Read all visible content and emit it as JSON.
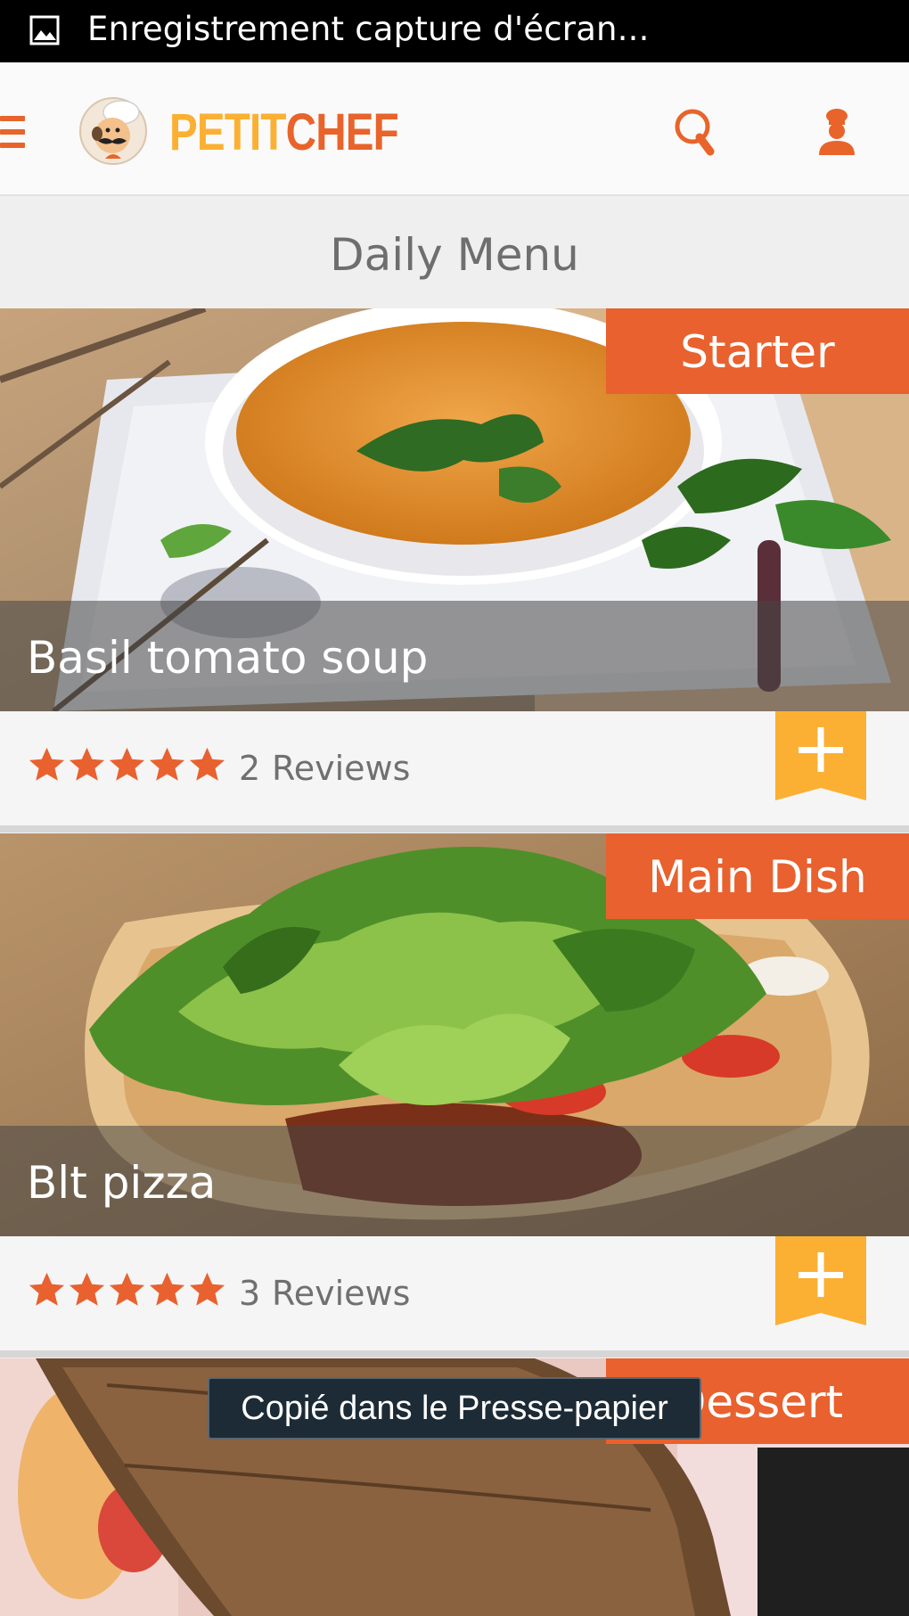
{
  "status_bar": {
    "notification_icon": "image-icon",
    "text": "Enregistrement capture d'écran..."
  },
  "app_bar": {
    "logo_petit": "PETIT",
    "logo_chef": "CHEF",
    "icons": [
      "menu-icon",
      "chef-avatar-icon",
      "search-icon",
      "chef-profile-icon"
    ],
    "brand_orange": "#e8642b",
    "brand_yellow": "#fbb033"
  },
  "section": {
    "title": "Daily Menu"
  },
  "cards": [
    {
      "category": "Starter",
      "title": "Basil tomato soup",
      "rating": 5,
      "review_count": "2",
      "review_label": "Reviews"
    },
    {
      "category": "Main Dish",
      "title": "Blt pizza",
      "rating": 5,
      "review_count": "3",
      "review_label": "Reviews"
    },
    {
      "category": "Dessert"
    }
  ],
  "toast": {
    "text": "Copié dans le Presse-papier"
  }
}
